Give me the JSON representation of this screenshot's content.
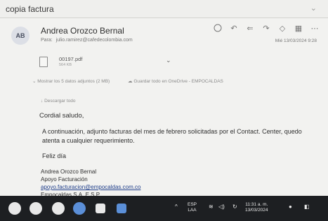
{
  "subject": "copia factura",
  "header": {
    "avatar_initials": "AB",
    "sender_name": "Andrea Orozco Bernal",
    "to_label": "Para:",
    "to_address": "julio.ramirez@cafedecolombia.com",
    "date": "Mié 13/03/2024 9:28"
  },
  "attachment": {
    "file_name": "00197.pdf",
    "file_size": "564 KB"
  },
  "attachment_actions": {
    "show_all": "Mostrar los 5 datos adjuntos (2 MB)",
    "save_all": "Guardar todo en OneDrive - EMPOCALDAS"
  },
  "download_label": "Descargar todo",
  "message": {
    "greeting": "Cordial saludo,",
    "paragraph": "A continuación, adjunto facturas del mes de febrero solicitadas por el Contact. Center, quedo atenta a cualquier requerimiento.",
    "closing": "Feliz día",
    "signature": {
      "name": "Andrea Orozco Bernal",
      "role": "Apoyo Facturación",
      "email": "apoyo.facturacion@empocaldas.com.co",
      "company": "Empocaldas S.A. E.S.P."
    }
  },
  "taskbar": {
    "language": "ESP",
    "layout": "LAA",
    "time": "11:31 a. m.",
    "date": "13/03/2024"
  }
}
